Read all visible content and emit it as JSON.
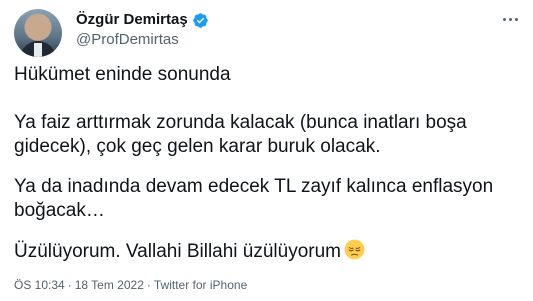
{
  "author": {
    "display_name": "Özgür Demirtaş",
    "handle": "@ProfDemirtas",
    "verified": true
  },
  "menu": {
    "icon": "more-horizontal-icon"
  },
  "tweet": {
    "paragraphs": [
      "Hükümet eninde sonunda",
      "Ya faiz arttırmak zorunda kalacak (bunca inatları boşa gidecek), çok geç gelen karar buruk olacak.",
      "Ya da inadında devam edecek TL zayıf kalınca enflasyon boğacak…",
      "Üzülüyorum. Vallahi Billahi üzülüyorum"
    ],
    "emoji": "pensive-face-emoji"
  },
  "meta": {
    "time": "ÖS 10:34",
    "separator": "·",
    "date": "18 Tem 2022",
    "source": "Twitter for iPhone"
  },
  "colors": {
    "text": "#0f1419",
    "secondary": "#536471",
    "verified_blue": "#1d9bf0"
  }
}
